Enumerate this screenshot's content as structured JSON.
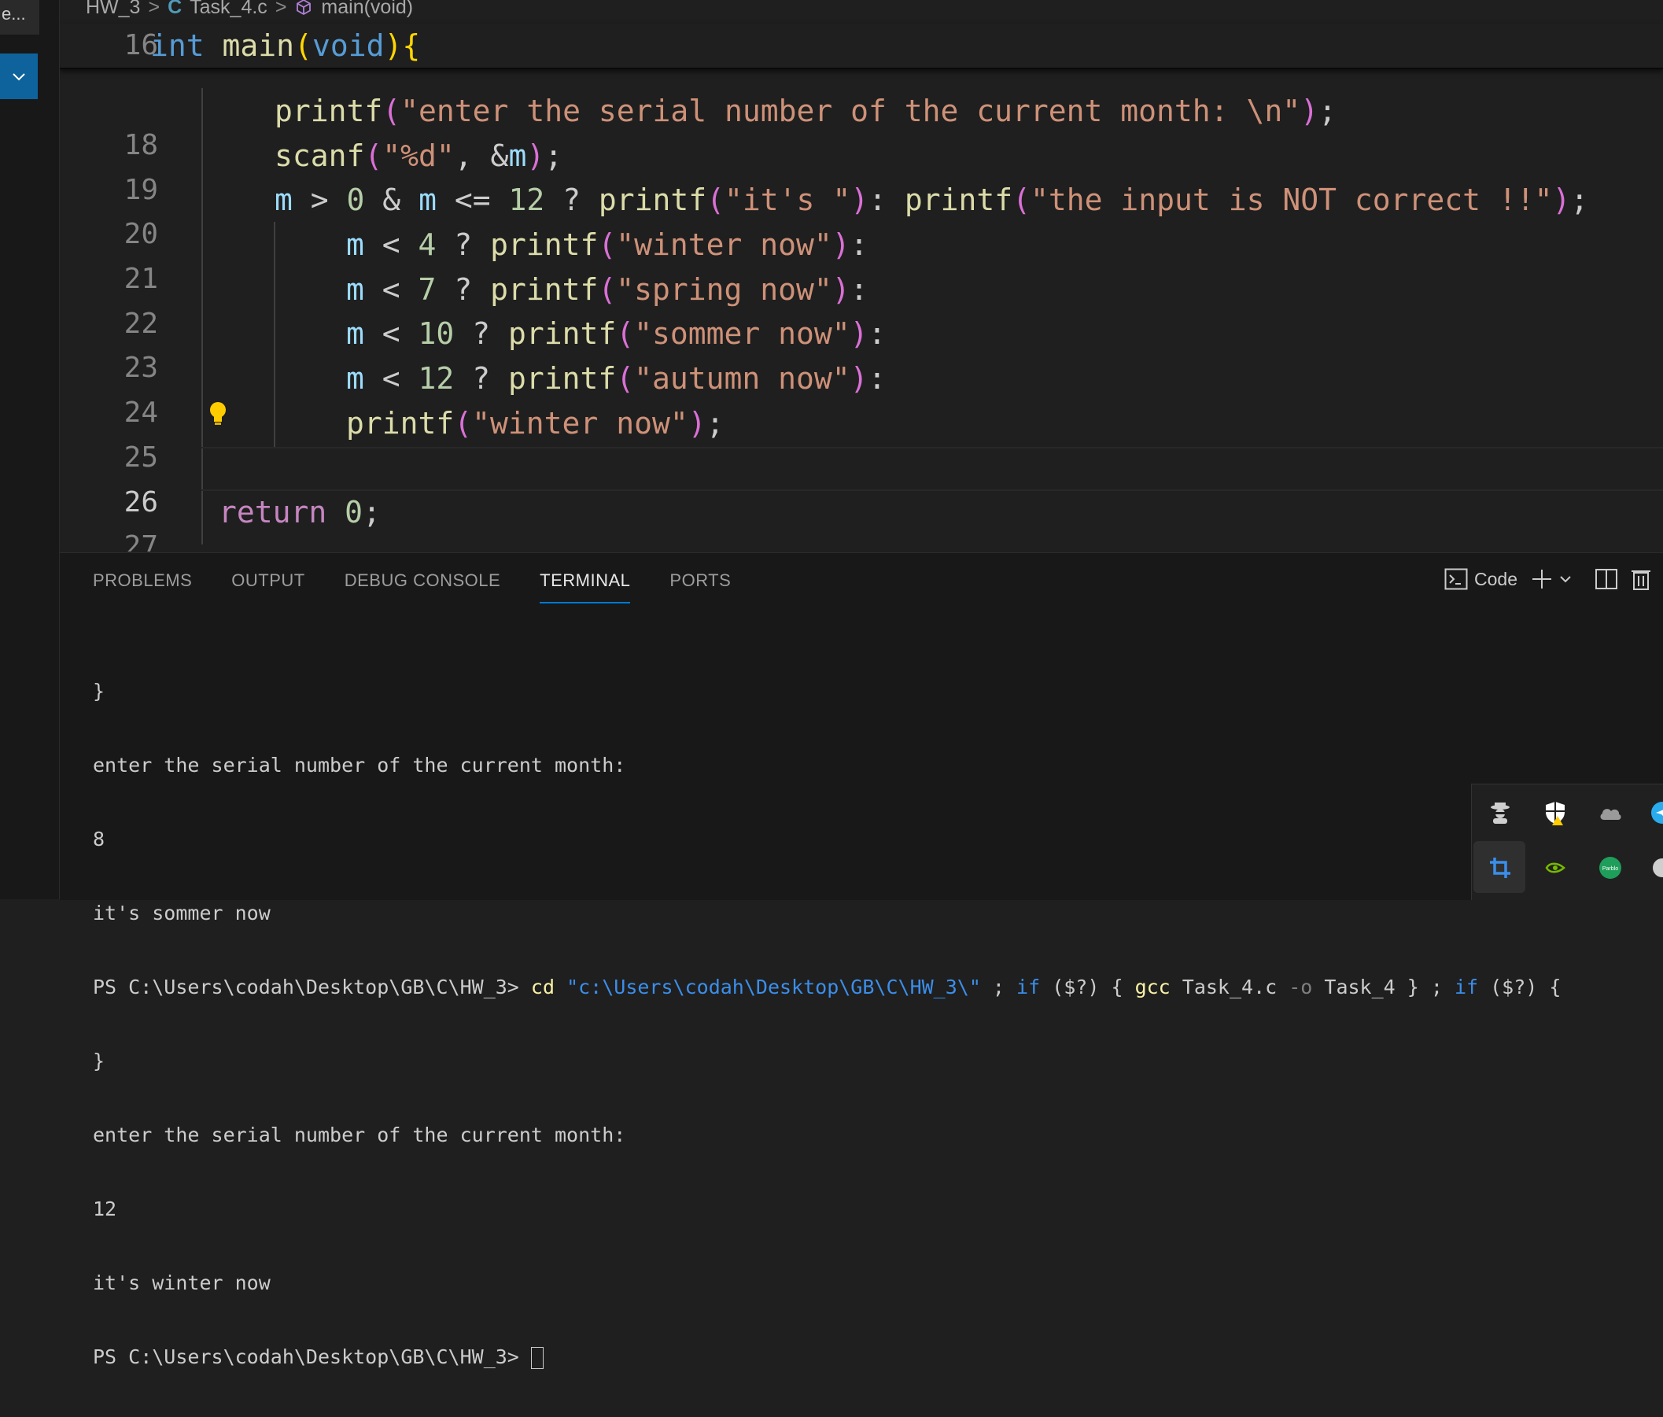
{
  "sidebar": {
    "top_label": "e...",
    "collapse_icon": "chevron-down-icon"
  },
  "breadcrumb": {
    "folder": "HW_3",
    "file": "Task_4.c",
    "file_icon_label": "C",
    "symbol": "main(void)"
  },
  "editor": {
    "sticky_line_number": "16",
    "sticky_code": [
      "int",
      " ",
      "main",
      "(",
      "void",
      ")",
      "{"
    ],
    "line_numbers": [
      "18",
      "19",
      "20",
      "21",
      "22",
      "23",
      "24",
      "25",
      "26",
      "27"
    ],
    "active_line": "26",
    "code": {
      "l18": {
        "fn": "printf",
        "str": "\"enter the serial number of the current month: \\n\"",
        "end": ";"
      },
      "l19": {
        "fn": "scanf",
        "str": "\"%d\"",
        "mid": ", &",
        "var": "m",
        "end": ";"
      },
      "l20": {
        "v1": "m",
        "op1": " > ",
        "n1": "0",
        "op2": " & ",
        "v2": "m",
        "op3": " <= ",
        "n2": "12",
        "op4": " ? ",
        "f1": "printf",
        "s1": "\"it's \"",
        "op5": ": ",
        "f2": "printf",
        "s2": "\"the input is NOT correct !!\"",
        "end": ";"
      },
      "l21": {
        "v": "m",
        "op": " < ",
        "n": "4",
        "q": " ? ",
        "f": "printf",
        "s": "\"winter now\"",
        "end": ":"
      },
      "l22": {
        "v": "m",
        "op": " < ",
        "n": "7",
        "q": " ? ",
        "f": "printf",
        "s": "\"spring now\"",
        "end": ":"
      },
      "l23": {
        "v": "m",
        "op": " < ",
        "n": "10",
        "q": " ? ",
        "f": "printf",
        "s": "\"sommer now\"",
        "end": ":"
      },
      "l24": {
        "v": "m",
        "op": " < ",
        "n": "12",
        "q": " ? ",
        "f": "printf",
        "s": "\"autumn now\"",
        "end": ":"
      },
      "l25": {
        "f": "printf",
        "s": "\"winter now\"",
        "end": ";"
      },
      "l27": {
        "kw": "return",
        "n": "0",
        "end": ";"
      }
    }
  },
  "panel": {
    "tabs": [
      "PROBLEMS",
      "OUTPUT",
      "DEBUG CONSOLE",
      "TERMINAL",
      "PORTS"
    ],
    "active_tab": "TERMINAL",
    "terminal_profile": "Code"
  },
  "terminal": {
    "lines": [
      "}",
      "enter the serial number of the current month:",
      "8",
      "it's sommer now"
    ],
    "cmd": {
      "prompt": "PS C:\\Users\\codah\\Desktop\\GB\\C\\HW_3> ",
      "cd": "cd",
      "path": "\"c:\\Users\\codah\\Desktop\\GB\\C\\HW_3\\\"",
      "sep1": " ; ",
      "if1": "if",
      "cond1": " ($?) { ",
      "gcc": "gcc",
      "args": " Task_4.c ",
      "flag": "-o",
      "out": " Task_4 } ; ",
      "if2": "if",
      "cond2": " ($?) {"
    },
    "lines2": [
      "}",
      "enter the serial number of the current month:",
      "12",
      "it's winter now"
    ],
    "last_prompt": "PS C:\\Users\\codah\\Desktop\\GB\\C\\HW_3> "
  },
  "tray": {
    "icons": [
      "spy-icon",
      "shield-warning-icon",
      "cloud-icon",
      "telegram-icon",
      "crop-icon",
      "nvidia-icon",
      "parblo-icon",
      "unknown-icon"
    ],
    "parblo_label": "Parblo"
  }
}
